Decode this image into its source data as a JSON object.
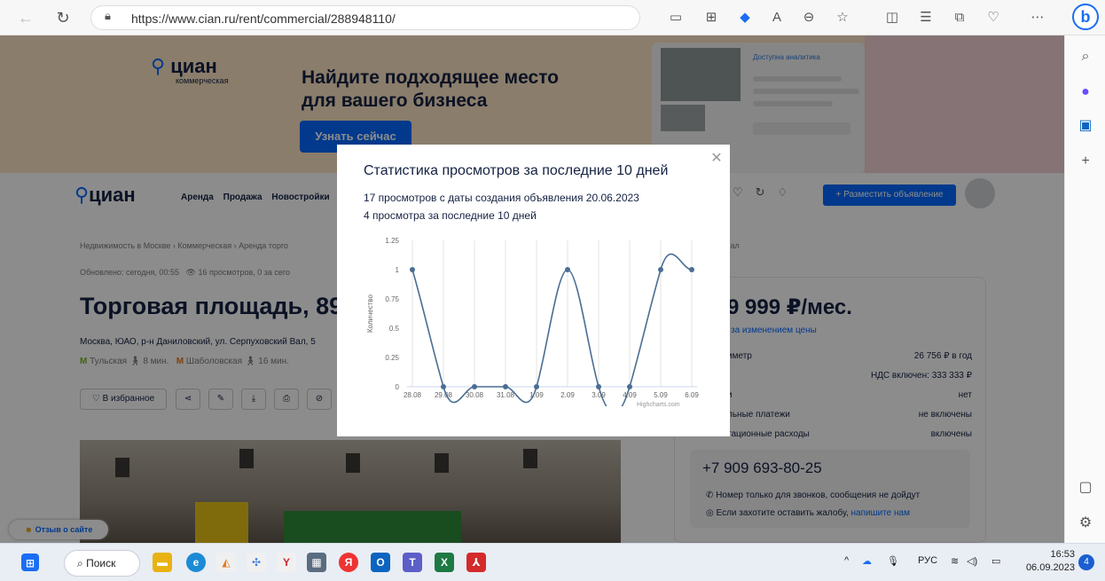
{
  "browser": {
    "url": "https://www.cian.ru/rent/commercial/288948110/"
  },
  "banner": {
    "logo": "циан",
    "logo_sub": "коммерческая",
    "title": "Найдите подходящее место для вашего бизнеса",
    "button": "Узнать сейчас",
    "card_label": "Доступна аналитика"
  },
  "header": {
    "logo": "циан",
    "nav": [
      "Аренда",
      "Продажа",
      "Новостройки"
    ],
    "post_button": "+ Разместить объявление"
  },
  "listing": {
    "breadcrumb": "Недвижимость в Москве › Коммерческая › Аренда торго",
    "breadcrumb_tail": "й Вал",
    "updated": "Обновлено: сегодня, 00:55",
    "views": "16 просмотров, 0 за сего",
    "title": "Торговая площадь, 89",
    "address": "Москва, ЮАО, р-н Даниловский, ул. Серпуховский Вал, 5",
    "metro1": "Тульская",
    "metro1_time": "8 мин.",
    "metro2": "Шаболовская",
    "metro2_time": "16 мин.",
    "fav_button": "В избранное"
  },
  "price_card": {
    "price": "9 999 ₽/мес.",
    "price_sub": "за изменением цены",
    "rows": [
      {
        "label": "иметр",
        "value": "26 756 ₽ в год"
      },
      {
        "label": "",
        "value": "НДС включен: 333 333 ₽"
      },
      {
        "label": "и",
        "value": "нет"
      },
      {
        "label": "льные платежи",
        "value": "не включены"
      },
      {
        "label": "тационные расходы",
        "value": "включены"
      }
    ],
    "phone": "+7 909 693-80-25",
    "note1": "Номер только для звонков, сообщения не дойдут",
    "note2_prefix": "Если захотите оставить жалобу,",
    "note2_link": "напишите нам"
  },
  "feedback_label": "Отзыв о сайте",
  "modal": {
    "title": "Статистика просмотров за последние 10 дней",
    "line1": "17 просмотров с даты создания объявления 20.06.2023",
    "line2": "4 просмотра за последние 10 дней",
    "credits": "Highcharts.com"
  },
  "chart_data": {
    "type": "line",
    "categories": [
      "28.08",
      "29.08",
      "30.08",
      "31.08",
      "1.09",
      "2.09",
      "3.09",
      "4.09",
      "5.09",
      "6.09"
    ],
    "values": [
      1,
      0,
      0,
      0,
      0,
      1,
      0,
      0,
      1,
      1
    ],
    "ylabel": "Количество",
    "yticks": [
      "0",
      "0.25",
      "0.5",
      "0.75",
      "1",
      "1.25"
    ],
    "ylim": [
      0,
      1.25
    ],
    "grid": "vertical",
    "color": "#4a6e94"
  },
  "taskbar": {
    "search": "Поиск",
    "lang": "РУС",
    "time": "16:53",
    "date": "06.09.2023",
    "notifications": "4"
  }
}
